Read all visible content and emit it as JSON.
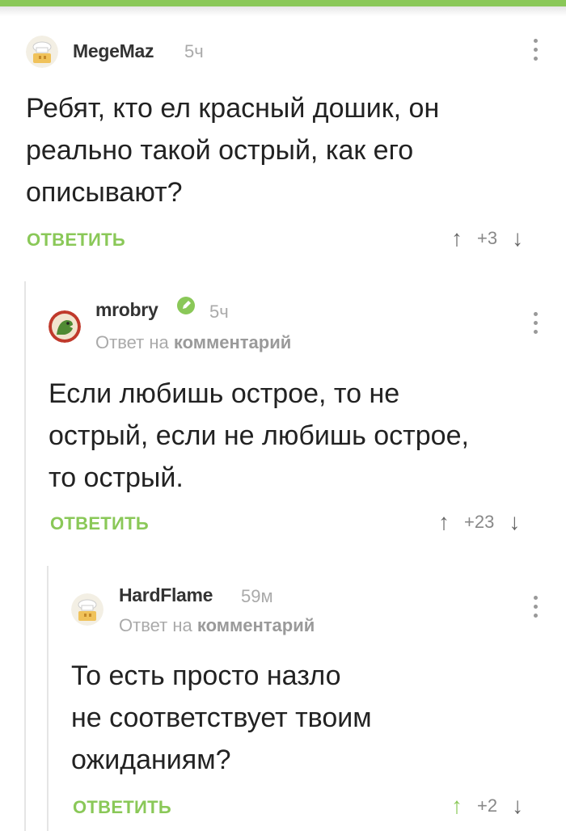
{
  "colors": {
    "accent": "#8ac858",
    "muted": "#aaaaaa",
    "text": "#222222"
  },
  "comments": [
    {
      "username": "MegeMaz",
      "time": "5ч",
      "text_lines": [
        "Ребят, кто ел красный дошик, он",
        "реально такой острый, как его",
        "описывают?"
      ],
      "reply_label": "ОТВЕТИТЬ",
      "score": "+3",
      "avatar_icon": "chef-hat-avatar"
    },
    {
      "username": "mrobry",
      "verified": true,
      "time": "5ч",
      "reply_to_prefix": "Ответ на",
      "reply_to_link": "комментарий",
      "text_lines": [
        "Если любишь острое, то не",
        "острый, если не любишь острое,",
        "то острый."
      ],
      "reply_label": "ОТВЕТИТЬ",
      "score": "+23",
      "avatar_icon": "dinosaur-avatar"
    },
    {
      "username": "HardFlame",
      "time": "59м",
      "reply_to_prefix": "Ответ на",
      "reply_to_link": "комментарий",
      "text_lines": [
        "То есть просто назло",
        "не соответствует твоим",
        "ожиданиям?"
      ],
      "reply_label": "ОТВЕТИТЬ",
      "score": "+2",
      "upvoted": true,
      "avatar_icon": "chef-hat-avatar"
    }
  ]
}
